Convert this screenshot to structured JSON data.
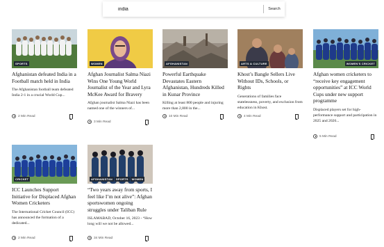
{
  "search": {
    "value": "india",
    "placeholder": "Search",
    "button_label": "Search"
  },
  "articles": [
    {
      "tags": [
        "SPORTS"
      ],
      "title": "Afghanistan defeated India in a Football match held in India",
      "excerpt": "The Afghanistan football team defeated India 2-1 in a crucial World Cup...",
      "read_time": "2 Min Read"
    },
    {
      "tags": [
        "WOMEN"
      ],
      "title": "Afghan Journalist Salma Niazi Wins One Young World Journalist of the Year and Lyra McKee Award for Bravery",
      "excerpt": "Afghan journalist Salma Niazi has been named one of the winners of...",
      "read_time": "3 Min Read"
    },
    {
      "tags": [
        "AFGHANISTAN"
      ],
      "title": "Powerful Earthquake Devastates Eastern Afghanistan, Hundreds Killed in Kunar Province",
      "excerpt": "Killing at least 800 people and injuring more than 2,800 in the...",
      "read_time": "10 Min Read"
    },
    {
      "tags": [
        "ARTS & CULTURE"
      ],
      "title": "Khost’s Bangle Sellers Live Without IDs, Schools, or Rights",
      "excerpt": "Generations of families face statelessness, poverty, and exclusion from education in Khost.",
      "read_time": "4 Min Read"
    },
    {
      "tags": [
        "WOMEN'S CRICKET"
      ],
      "title": "Afghan women cricketers to “receive key engagement opportunities” at ICC World Cups under new support programme",
      "excerpt": "Displaced players set for high-performance support and participation in 2025 and 2026...",
      "read_time": "5 Min Read"
    },
    {
      "tags": [
        "CRICKET"
      ],
      "title": "ICC Launches Support Initiative for Displaced Afghan Women Cricketers",
      "excerpt": "The International Cricket Council (ICC) has announced the formation of a dedicated...",
      "read_time": "2 Min Read"
    },
    {
      "tags": [
        "AFGHANISTAN",
        "SPORTS",
        "WOMEN"
      ],
      "title": "“Two years away from sports, I feel like I’m not alive”: Afghan sportswomen ongoing struggles under Taliban Rule",
      "excerpt": "ISLAMABAD, October 16, 2023 - “How long will we not be allowed...",
      "read_time": "34 Min Read"
    }
  ],
  "colors": {
    "tag_bg": "#1f2733",
    "text": "#111111",
    "meta": "#555555"
  },
  "icons": {
    "read_time": "clock-icon",
    "save": "bookmark-icon"
  }
}
